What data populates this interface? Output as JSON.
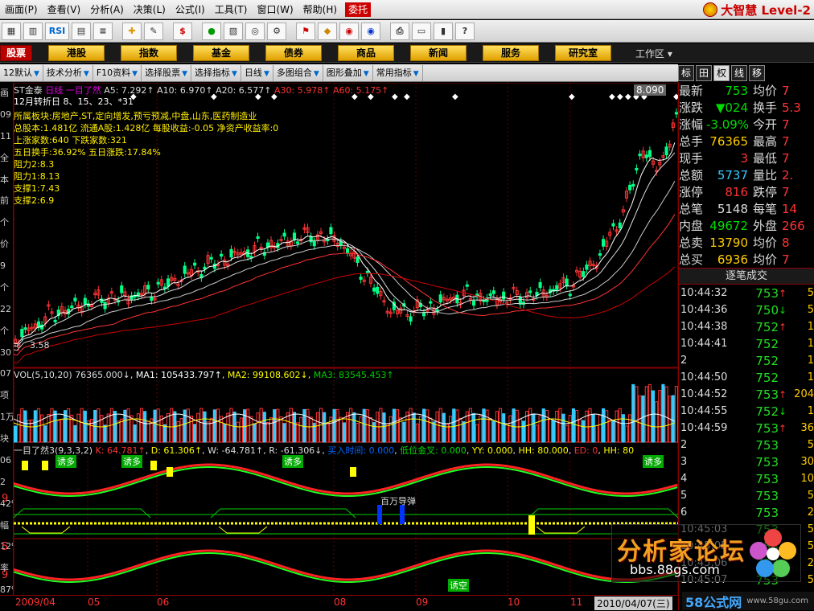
{
  "menu": {
    "items": [
      "画面(P)",
      "查看(V)",
      "分析(A)",
      "决策(L)",
      "公式(I)",
      "工具(T)",
      "窗口(W)",
      "帮助(H)"
    ],
    "weituo": "委托",
    "brand": "大智慧 Level-2"
  },
  "toolbar": {
    "rsi": "RSI",
    "dollar": "$"
  },
  "nav": {
    "items": [
      "股票",
      "港股",
      "指数",
      "基金",
      "债券",
      "商品",
      "新闻",
      "服务",
      "研究室"
    ],
    "workarea": "工作区"
  },
  "subtool": {
    "items": [
      "12默认",
      "技术分析",
      "F10资料",
      "选择股票",
      "选择指标",
      "日线",
      "多图组合",
      "图形叠加",
      "常用指标"
    ]
  },
  "right_tabs": [
    "标",
    "田",
    "权",
    "线",
    "移"
  ],
  "left_strip": [
    "画",
    "09",
    "11",
    "全",
    "本",
    "前",
    "个",
    "价",
    "9",
    "个",
    "22",
    "个",
    "30",
    "07",
    "项",
    "1万",
    "块",
    "06",
    "2",
    "42%",
    "幅",
    "12%",
    "率",
    "87%"
  ],
  "header": {
    "stock": "ST金泰",
    "period": "日线",
    "indicator": "一目了然",
    "ma5": "A5: 7.292↑",
    "ma10": "A10: 6.970↑",
    "ma20": "A20: 6.577↑",
    "ma30": "A30: 5.978↑",
    "ma60": "A60: 5.175↑",
    "price_tag": "8.090"
  },
  "info": {
    "line1": "12月转折日 8、15、23、*31",
    "line2": "所属板块:房地产,ST,定向增发,预亏预减,中盘,山东,医药制造业",
    "line3": "总股本:1.481亿 流通A股:1.428亿 每股收益:-0.05 净资产收益率:0",
    "line4": "上涨家数:640     下跌家数:321",
    "line5": "五日换手:36.92%    五日涨跌:17.84%",
    "line6": "阻力2:8.3",
    "line7": "阻力1:8.13",
    "line8": "支撑1:7.43",
    "line9": "支撑2:6.9",
    "low_label": "3.58"
  },
  "vol_header": {
    "name": "VOL(5,10,20)",
    "v": "76365.000↓",
    "ma1": "MA1: 105433.797↑",
    "ma2": "MA2: 99108.602↓",
    "ma3": "MA3: 83545.453↑"
  },
  "ind_header": {
    "name": "一目了然3(9,3,3,2)",
    "k": "K: 64.781↑",
    "d": "D: 61.306↑",
    "w": "W: -64.781↑",
    "r": "R: -61.306↓",
    "buy": "买入时间: 0.000",
    "gold": "低位金叉: 0.000",
    "yy": "YY: 0.000",
    "hh": "HH: 80.000",
    "ed": "ED: 0",
    "hh2": "HH: 80"
  },
  "signals": {
    "youduo": "诱多",
    "baiwan": "百万导弹",
    "youkong": "诱空"
  },
  "left_axis": {
    "a": "9",
    "b": "5",
    "c": "9"
  },
  "date_axis": [
    "2009/04",
    "05",
    "06",
    "08",
    "09",
    "10",
    "11",
    "2010/04/07(三)"
  ],
  "quote": {
    "rows": [
      {
        "k1": "最新",
        "v1": "753",
        "c1": "#00dd00",
        "k2": "均价",
        "v2": "7"
      },
      {
        "k1": "涨跌",
        "v1": "▼024",
        "c1": "#00dd00",
        "k2": "换手",
        "v2": "5.3"
      },
      {
        "k1": "涨幅",
        "v1": "-3.09%",
        "c1": "#00dd00",
        "k2": "今开",
        "v2": "7"
      },
      {
        "k1": "总手",
        "v1": "76365",
        "c1": "#ffcc00",
        "k2": "最高",
        "v2": "7"
      },
      {
        "k1": "现手",
        "v1": "3",
        "c1": "#ff3333",
        "k2": "最低",
        "v2": "7"
      },
      {
        "k1": "总额",
        "v1": "5737",
        "c1": "#33ccff",
        "k2": "量比",
        "v2": "2."
      },
      {
        "k1": "涨停",
        "v1": "816",
        "c1": "#ff3333",
        "k2": "跌停",
        "v2": "7"
      },
      {
        "k1": "总笔",
        "v1": "5148",
        "c1": "#dddddd",
        "k2": "每笔",
        "v2": "14"
      },
      {
        "k1": "内盘",
        "v1": "49672",
        "c1": "#00dd00",
        "k2": "外盘",
        "v2": "266"
      },
      {
        "k1": "总卖",
        "v1": "13790",
        "c1": "#ffcc00",
        "k2": "均价",
        "v2": "8"
      },
      {
        "k1": "总买",
        "v1": "6936",
        "c1": "#ffcc00",
        "k2": "均价",
        "v2": "7"
      }
    ]
  },
  "trade": {
    "title": "逐笔成交",
    "rows": [
      {
        "t": "10:44:32",
        "p": "753",
        "a": "↑",
        "ac": "#ff3333",
        "v": "5"
      },
      {
        "t": "10:44:36",
        "p": "750",
        "a": "↓",
        "ac": "#00dd00",
        "v": "5"
      },
      {
        "t": "10:44:38",
        "p": "752",
        "a": "↑",
        "ac": "#ff3333",
        "v": "1"
      },
      {
        "t": "10:44:41",
        "p": "752",
        "a": "",
        "ac": "#ff3333",
        "v": "1"
      },
      {
        "t": "2",
        "p": "752",
        "a": "",
        "ac": "#ff3333",
        "v": "1"
      },
      {
        "t": "10:44:50",
        "p": "752",
        "a": "",
        "ac": "#ff3333",
        "v": "1"
      },
      {
        "t": "10:44:52",
        "p": "753",
        "a": "↑",
        "ac": "#ff3333",
        "v": "204"
      },
      {
        "t": "10:44:55",
        "p": "752",
        "a": "↓",
        "ac": "#00dd00",
        "v": "1"
      },
      {
        "t": "10:44:59",
        "p": "753",
        "a": "↑",
        "ac": "#ff3333",
        "v": "36"
      },
      {
        "t": "2",
        "p": "753",
        "a": "",
        "ac": "#ff3333",
        "v": "5"
      },
      {
        "t": "3",
        "p": "753",
        "a": "",
        "ac": "#ff3333",
        "v": "30"
      },
      {
        "t": "4",
        "p": "753",
        "a": "",
        "ac": "#ff3333",
        "v": "10"
      },
      {
        "t": "5",
        "p": "753",
        "a": "",
        "ac": "#ff3333",
        "v": "5"
      },
      {
        "t": "6",
        "p": "753",
        "a": "",
        "ac": "#ff3333",
        "v": "2"
      },
      {
        "t": "10:45:03",
        "p": "753",
        "a": "",
        "ac": "#ff3333",
        "v": "5"
      },
      {
        "t": "10:45:05",
        "p": "753",
        "a": "",
        "ac": "#ff3333",
        "v": "5"
      },
      {
        "t": "10:45:06",
        "p": "753",
        "a": "",
        "ac": "#ff3333",
        "v": "2"
      },
      {
        "t": "10:45:07",
        "p": "753",
        "a": "",
        "ac": "#ff3333",
        "v": "5"
      }
    ]
  },
  "watermark": {
    "t1": "分析家论坛",
    "t2": "bbs.88gs.com",
    "t3": "58公式网",
    "t4": "www.58gu.com"
  }
}
